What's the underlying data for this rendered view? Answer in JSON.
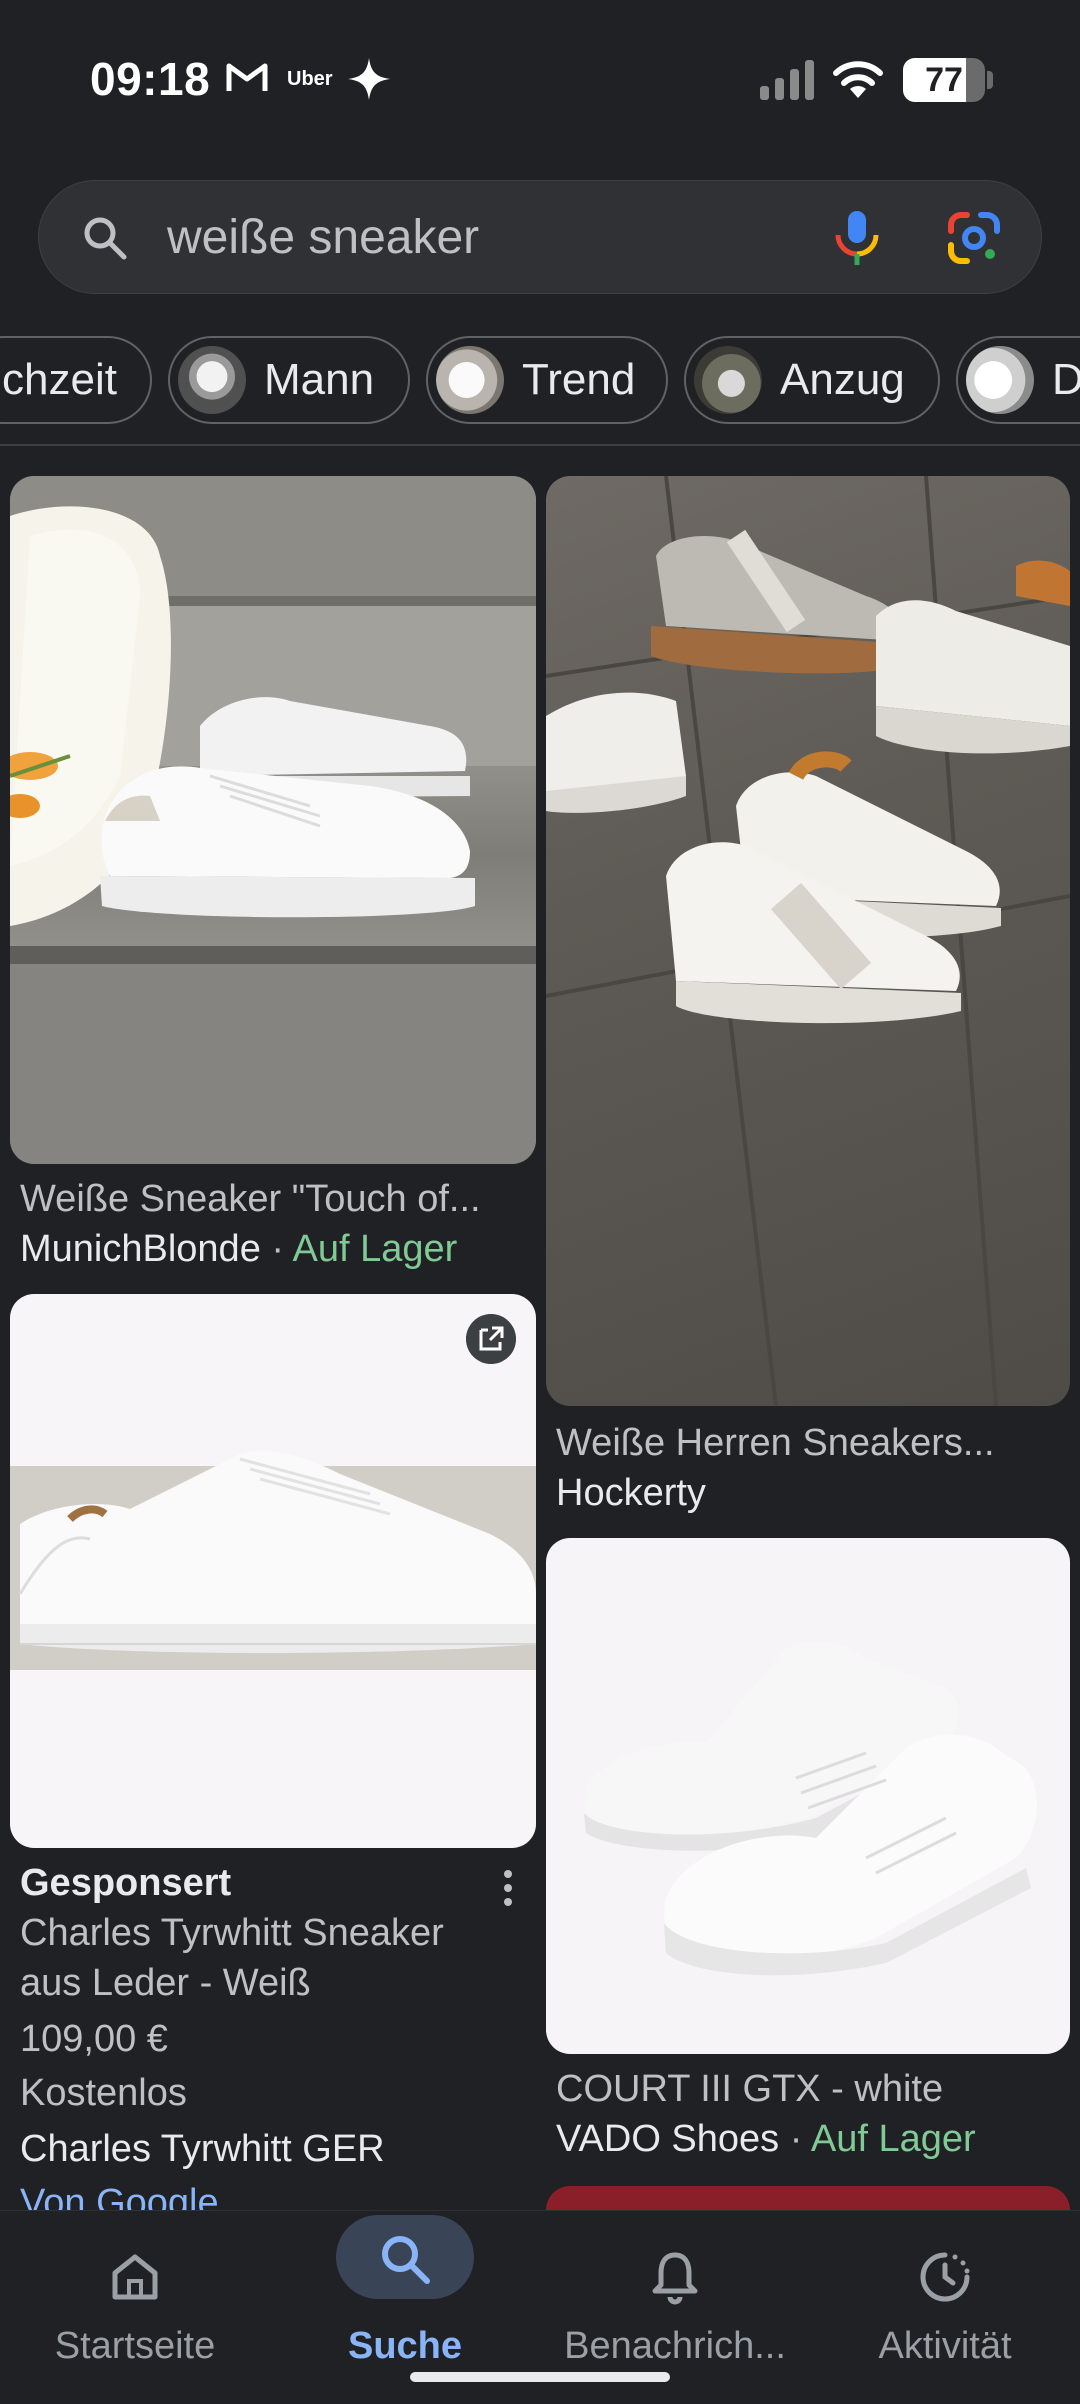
{
  "status_bar": {
    "time": "09:18",
    "uber_label": "Uber",
    "battery_percent": "77",
    "battery_level": 0.77
  },
  "search": {
    "query": "weiße sneaker"
  },
  "chips": [
    {
      "label": "chzeit"
    },
    {
      "label": "Mann"
    },
    {
      "label": "Trend"
    },
    {
      "label": "Anzug"
    },
    {
      "label": "D"
    }
  ],
  "results": [
    {
      "title": "Weiße Sneaker \"Touch of...",
      "source": "MunichBlonde",
      "separator": " · ",
      "stock": "Auf Lager"
    },
    {
      "title": "Weiße Herren Sneakers...",
      "source": "Hockerty"
    },
    {
      "sponsored": "Gesponsert",
      "title_line1": "Charles Tyrwhitt Sneaker",
      "title_line2": "aus Leder - Weiß",
      "price": "109,00 €",
      "shipping": "Kostenlos",
      "source": "Charles Tyrwhitt GER",
      "via": "Von Google"
    },
    {
      "title": "COURT III GTX - white",
      "source": "VADO Shoes",
      "separator": " · ",
      "stock": "Auf Lager"
    }
  ],
  "bottom_nav": [
    {
      "label": "Startseite",
      "icon": "home-icon",
      "active": false
    },
    {
      "label": "Suche",
      "icon": "search-icon",
      "active": true
    },
    {
      "label": "Benachrich...",
      "icon": "bell-icon",
      "active": false
    },
    {
      "label": "Aktivität",
      "icon": "activity-icon",
      "active": false
    }
  ],
  "colors": {
    "background": "#202124",
    "accent": "#8ab4f8",
    "in_stock": "#81c995"
  }
}
